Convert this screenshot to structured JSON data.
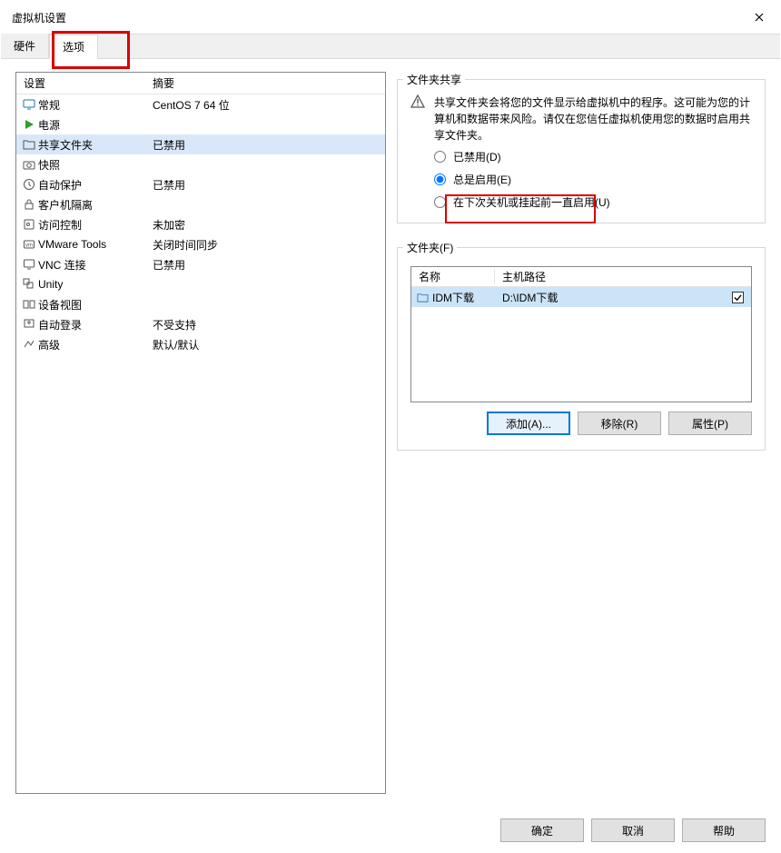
{
  "title": "虚拟机设置",
  "tabs": {
    "hardware": "硬件",
    "options": "选项"
  },
  "left": {
    "headers": {
      "setting": "设置",
      "summary": "摘要"
    },
    "rows": [
      {
        "icon": "monitor-icon",
        "name": "常规",
        "summary": "CentOS 7 64 位"
      },
      {
        "icon": "play-icon",
        "name": "电源",
        "summary": ""
      },
      {
        "icon": "folder-icon",
        "name": "共享文件夹",
        "summary": "已禁用",
        "selected": true
      },
      {
        "icon": "camera-icon",
        "name": "快照",
        "summary": ""
      },
      {
        "icon": "clock-icon",
        "name": "自动保护",
        "summary": "已禁用"
      },
      {
        "icon": "lock-icon",
        "name": "客户机隔离",
        "summary": ""
      },
      {
        "icon": "key-icon",
        "name": "访问控制",
        "summary": "未加密"
      },
      {
        "icon": "vm-tools-icon",
        "name": "VMware Tools",
        "summary": "关闭时间同步"
      },
      {
        "icon": "vnc-icon",
        "name": "VNC 连接",
        "summary": "已禁用"
      },
      {
        "icon": "unity-icon",
        "name": "Unity",
        "summary": ""
      },
      {
        "icon": "device-icon",
        "name": "设备视图",
        "summary": ""
      },
      {
        "icon": "login-icon",
        "name": "自动登录",
        "summary": "不受支持"
      },
      {
        "icon": "advanced-icon",
        "name": "高级",
        "summary": "默认/默认"
      }
    ]
  },
  "share": {
    "legend": "文件夹共享",
    "warning": "共享文件夹会将您的文件显示给虚拟机中的程序。这可能为您的计算机和数据带来风险。请仅在您信任虚拟机使用您的数据时启用共享文件夹。",
    "radios": {
      "disabled": "已禁用(D)",
      "always": "总是启用(E)",
      "until": "在下次关机或挂起前一直启用(U)"
    }
  },
  "folders": {
    "legend": "文件夹(F)",
    "headers": {
      "name": "名称",
      "hostpath": "主机路径"
    },
    "row": {
      "name": "IDM下载",
      "path": "D:\\IDM下载"
    },
    "buttons": {
      "add": "添加(A)...",
      "remove": "移除(R)",
      "props": "属性(P)"
    }
  },
  "footer": {
    "ok": "确定",
    "cancel": "取消",
    "help": "帮助"
  }
}
